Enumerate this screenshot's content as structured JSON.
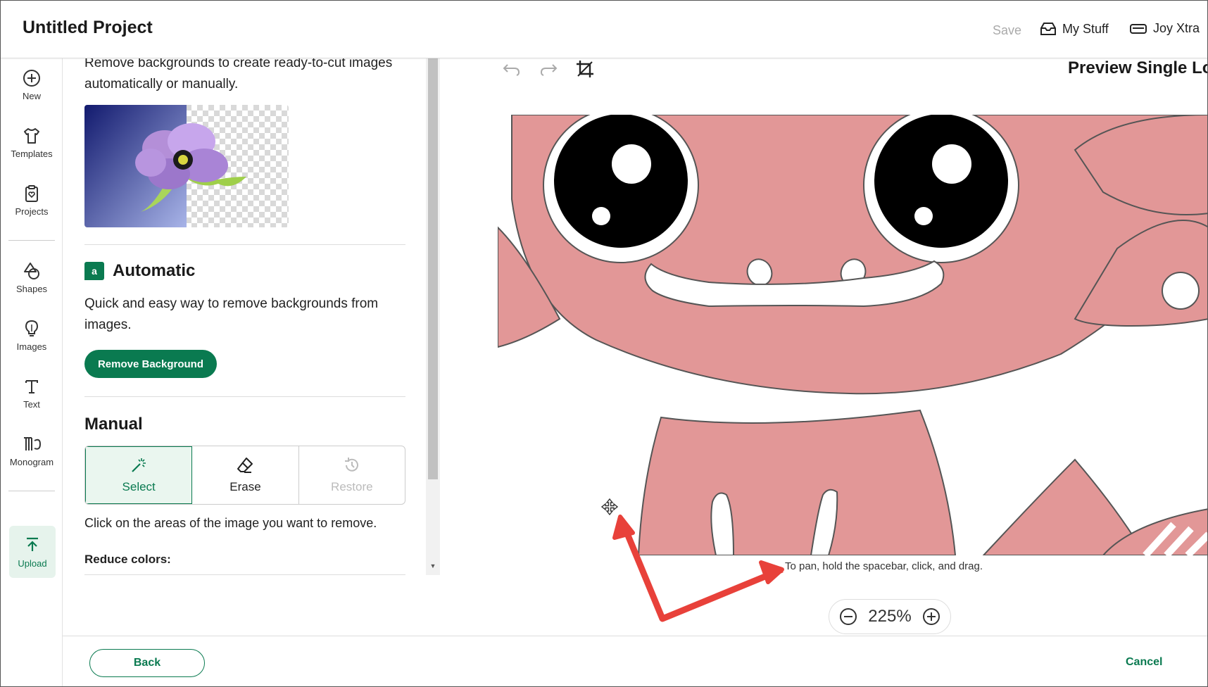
{
  "header": {
    "title": "Untitled Project",
    "save_label": "Save",
    "my_stuff_label": "My Stuff",
    "joy_label": "Joy Xtra"
  },
  "rail": {
    "items": [
      {
        "label": "New",
        "icon": "plus-circle-icon"
      },
      {
        "label": "Templates",
        "icon": "tshirt-icon"
      },
      {
        "label": "Projects",
        "icon": "clipboard-heart-icon"
      },
      {
        "label": "Shapes",
        "icon": "shapes-icon"
      },
      {
        "label": "Images",
        "icon": "lightbulb-icon"
      },
      {
        "label": "Text",
        "icon": "text-t-icon"
      },
      {
        "label": "Monogram",
        "icon": "monogram-icon"
      },
      {
        "label": "Upload",
        "icon": "upload-arrow-icon"
      }
    ]
  },
  "panel": {
    "intro": "Remove backgrounds to create ready-to-cut images automatically or manually.",
    "automatic": {
      "badge": "a",
      "title": "Automatic",
      "description": "Quick and easy way to remove backgrounds from images.",
      "button": "Remove Background"
    },
    "manual": {
      "title": "Manual",
      "modes": [
        {
          "label": "Select",
          "icon": "magic-wand-icon",
          "active": true,
          "disabled": false
        },
        {
          "label": "Erase",
          "icon": "eraser-icon",
          "active": false,
          "disabled": false
        },
        {
          "label": "Restore",
          "icon": "restore-history-icon",
          "active": false,
          "disabled": true
        }
      ],
      "description": "Click on the areas of the image you want to remove.",
      "reduce_colors_label": "Reduce colors:"
    }
  },
  "canvas": {
    "preview_title": "Preview Single Lo",
    "pan_hint": "To pan, hold the spacebar, click, and drag.",
    "zoom_level": "225%",
    "zoom_out_symbol": "−",
    "zoom_in_symbol": "+"
  },
  "footer": {
    "back_label": "Back",
    "cancel_label": "Cancel"
  },
  "colors": {
    "accent": "#0a7a50",
    "art_fill": "#e29797",
    "annotation_arrow": "#e8413a"
  }
}
